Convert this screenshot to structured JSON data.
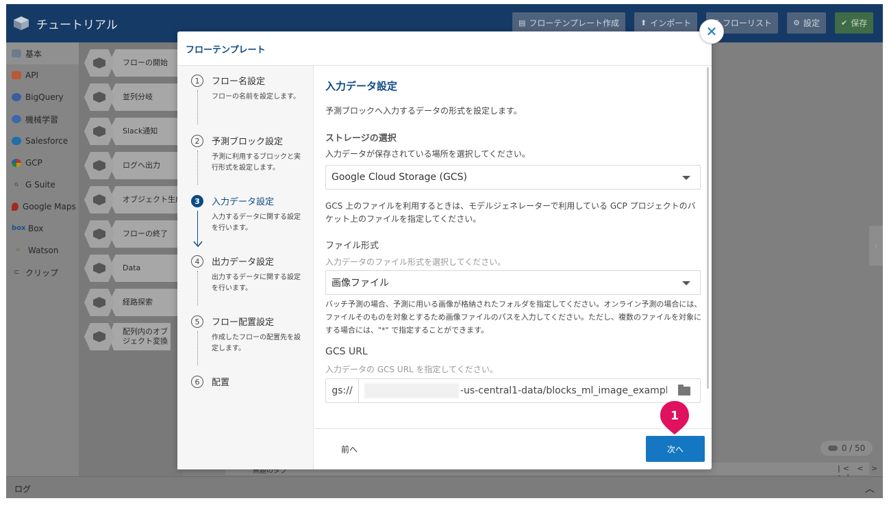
{
  "app": {
    "title": "チュートリアル"
  },
  "header_buttons": {
    "flow_template": "フローテンプレート作成",
    "import": "インポート",
    "flow_list": "フローリスト",
    "settings": "設定",
    "save": "保存"
  },
  "sidebar": {
    "items": [
      {
        "label": "基本",
        "icon": "blocks-logo-icon"
      },
      {
        "label": "API",
        "icon": "api-icon"
      },
      {
        "label": "BigQuery",
        "icon": "bigquery-icon"
      },
      {
        "label": "機械学習",
        "icon": "brain-icon"
      },
      {
        "label": "Salesforce",
        "icon": "salesforce-cloud-icon"
      },
      {
        "label": "GCP",
        "icon": "gcp-icon"
      },
      {
        "label": "G Suite",
        "icon": "gsuite-icon"
      },
      {
        "label": "Google Maps",
        "icon": "map-pin-icon"
      },
      {
        "label": "Box",
        "icon": "box-icon"
      },
      {
        "label": "Watson",
        "icon": "watson-icon"
      },
      {
        "label": "クリップ",
        "icon": "paperclip-icon"
      }
    ]
  },
  "blocks": {
    "items": [
      "フローの開始",
      "並列分岐",
      "Slack通知",
      "ログへ出力",
      "オブジェクト生成",
      "フローの終了",
      "Data",
      "経路探索",
      "配列内のオブジェクト変換"
    ]
  },
  "right_panel": {
    "counter": "0 / 50",
    "pager": "|< < > >|",
    "tab_label": "無題のタブ"
  },
  "log_bar": {
    "label": "ログ"
  },
  "modal": {
    "title": "フローテンプレート",
    "steps": [
      {
        "num": "1",
        "name": "フロー名設定",
        "desc": "フローの名前を設定します。"
      },
      {
        "num": "2",
        "name": "予測ブロック設定",
        "desc": "予測に利用するブロックと実行形式を設定します。"
      },
      {
        "num": "3",
        "name": "入力データ設定",
        "desc": "入力するデータに関する設定を行います。"
      },
      {
        "num": "4",
        "name": "出力データ設定",
        "desc": "出力するデータに関する設定を行います。"
      },
      {
        "num": "5",
        "name": "フロー配置設定",
        "desc": "作成したフローの配置先を設定します。"
      },
      {
        "num": "6",
        "name": "配置",
        "desc": ""
      }
    ],
    "content": {
      "heading": "入力データ設定",
      "intro": "予測ブロックへ入力するデータの形式を設定します。",
      "storage": {
        "heading": "ストレージの選択",
        "hint": "入力データが保存されている場所を選択してください。",
        "selected": "Google Cloud Storage (GCS)",
        "note": "GCS 上のファイルを利用するときは、モデルジェネレーターで利用している GCP プロジェクトのバケット上のファイルを指定してください。"
      },
      "file_format": {
        "label": "ファイル形式",
        "hint": "入力データのファイル形式を選択してください。",
        "selected": "画像ファイル",
        "note": "バッチ予測の場合、予測に用いる画像が格納されたフォルダを指定してください。オンライン予測の場合には、ファイルそのものを対象とするため画像ファイルのパスを入力してください。ただし、複数のファイルを対象にする場合には、\"*\" で指定することができます。"
      },
      "gcs_url": {
        "label": "GCS URL",
        "hint": "入力データの GCS URL を指定してください。",
        "prefix": "gs://",
        "value": "-us-central1-data/blocks_ml_image_exampl"
      }
    },
    "footer": {
      "prev": "前へ",
      "next": "次へ"
    },
    "marker_number": "1"
  },
  "colors": {
    "header_bg": "#153a66",
    "accent": "#1577c1",
    "active_step": "#0d4a85",
    "marker": "#e0115f"
  }
}
